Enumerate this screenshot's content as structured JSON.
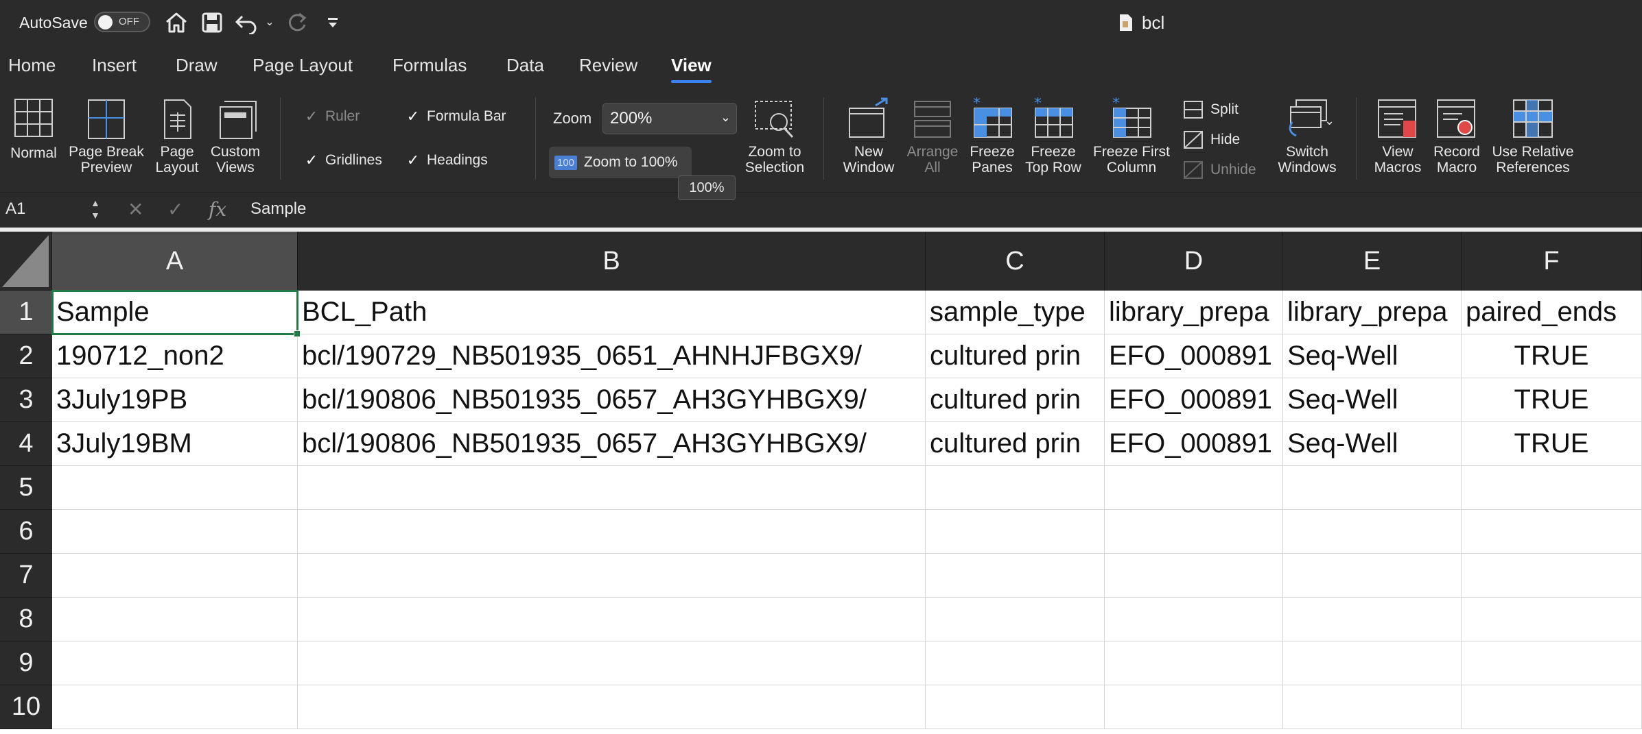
{
  "titlebar": {
    "autosave_label": "AutoSave",
    "autosave_state": "OFF",
    "doc_title": "bcl"
  },
  "ribbon_tabs": [
    {
      "label": "Home"
    },
    {
      "label": "Insert"
    },
    {
      "label": "Draw"
    },
    {
      "label": "Page Layout"
    },
    {
      "label": "Formulas"
    },
    {
      "label": "Data"
    },
    {
      "label": "Review"
    },
    {
      "label": "View",
      "active": true
    }
  ],
  "ribbon": {
    "views": {
      "normal": "Normal",
      "page_break_1": "Page Break",
      "page_break_2": "Preview",
      "page_layout_1": "Page",
      "page_layout_2": "Layout",
      "custom_views_1": "Custom",
      "custom_views_2": "Views"
    },
    "show": {
      "ruler": "Ruler",
      "formula_bar": "Formula Bar",
      "gridlines": "Gridlines",
      "headings": "Headings"
    },
    "zoom": {
      "label": "Zoom",
      "value": "200%",
      "zoom_to_100": "Zoom to 100%",
      "badge": "100",
      "tooltip": "100%",
      "zoom_sel_1": "Zoom to",
      "zoom_sel_2": "Selection"
    },
    "window": {
      "new_window_1": "New",
      "new_window_2": "Window",
      "arrange_1": "Arrange",
      "arrange_2": "All",
      "freeze_panes_1": "Freeze",
      "freeze_panes_2": "Panes",
      "freeze_top_1": "Freeze",
      "freeze_top_2": "Top Row",
      "freeze_first_1": "Freeze First",
      "freeze_first_2": "Column",
      "split": "Split",
      "hide": "Hide",
      "unhide": "Unhide",
      "switch_1": "Switch",
      "switch_2": "Windows"
    },
    "macros": {
      "view_1": "View",
      "view_2": "Macros",
      "record_1": "Record",
      "record_2": "Macro",
      "relative_1": "Use Relative",
      "relative_2": "References"
    }
  },
  "formula_bar": {
    "name_box": "A1",
    "value": "Sample"
  },
  "sheet": {
    "columns": [
      "A",
      "B",
      "C",
      "D",
      "E",
      "F"
    ],
    "row_numbers": [
      "1",
      "2",
      "3",
      "4",
      "5",
      "6",
      "7",
      "8",
      "9",
      "10"
    ],
    "rows": [
      [
        "Sample",
        "BCL_Path",
        "sample_type",
        "library_prepa",
        "library_prepa",
        "paired_ends"
      ],
      [
        "190712_non2",
        "bcl/190729_NB501935_0651_AHNHJFBGX9/",
        "cultured prin",
        "EFO_000891",
        "Seq-Well",
        "TRUE"
      ],
      [
        "3July19PB",
        "bcl/190806_NB501935_0657_AH3GYHBGX9/",
        "cultured prin",
        "EFO_000891",
        "Seq-Well",
        "TRUE"
      ],
      [
        "3July19BM",
        "bcl/190806_NB501935_0657_AH3GYHBGX9/",
        "cultured prin",
        "EFO_000891",
        "Seq-Well",
        "TRUE"
      ]
    ]
  }
}
